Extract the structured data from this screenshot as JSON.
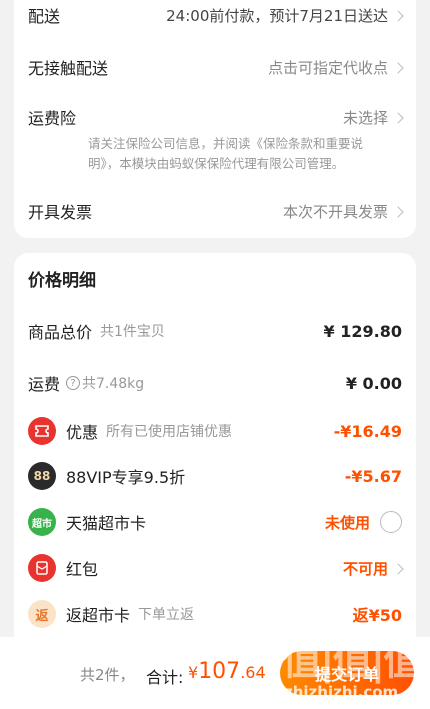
{
  "delivery": {
    "label": "配送",
    "value": "24:00前付款，预计7月21日送达"
  },
  "contactless": {
    "label": "无接触配送",
    "value": "点击可指定代收点"
  },
  "shipping_insurance": {
    "label": "运费险",
    "value": "未选择",
    "notice": "请关注保险公司信息，并阅读《保险条款和重要说明》，本模块由蚂蚁保保险代理有限公司管理。"
  },
  "invoice": {
    "label": "开具发票",
    "value": "本次不开具发票"
  },
  "price_detail": {
    "title": "价格明细",
    "goods_total": {
      "label": "商品总价",
      "sub": "共1件宝贝",
      "amount": "¥ 129.80"
    },
    "shipping": {
      "label": "运费",
      "sub": "共7.48kg",
      "amount": "¥ 0.00"
    },
    "discount": {
      "icon": "coupon-icon",
      "label": "优惠",
      "sub": "所有已使用店铺优惠",
      "amount": "-¥16.49"
    },
    "vip": {
      "icon_text": "88",
      "label": "88VIP专享9.5折",
      "amount": "-¥5.67"
    },
    "tmall_card": {
      "icon_text": "超市",
      "label": "天猫超市卡",
      "status": "未使用"
    },
    "hongbao": {
      "icon": "red-envelope-icon",
      "label": "红包",
      "status": "不可用"
    },
    "rebate": {
      "icon_text": "返",
      "label": "返超市卡",
      "sub": "下单立返",
      "amount": "返¥50"
    }
  },
  "footer": {
    "count": "共2件，",
    "total_label": "合计:",
    "currency": "¥",
    "total_int": "107",
    "total_dec": ".64",
    "submit": "提交订单"
  },
  "watermark": {
    "text": "值|值|值",
    "url": "zhizhizhi.com"
  },
  "colors": {
    "accent": "#ff5000",
    "background": "#f2f2f2"
  }
}
